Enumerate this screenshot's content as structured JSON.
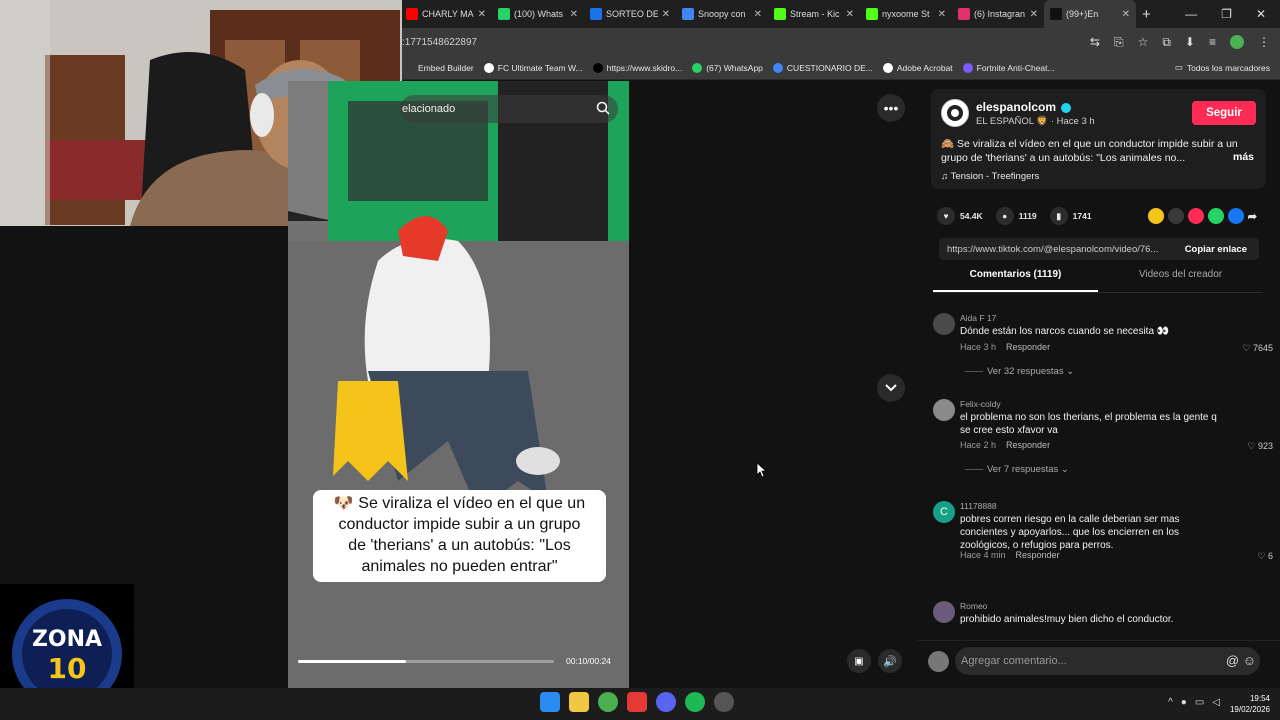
{
  "browser": {
    "tabs": [
      {
        "label": "CHARLY MA",
        "color": "#ff0000"
      },
      {
        "label": "(100) Whats",
        "color": "#25d366"
      },
      {
        "label": "SORTEO DE",
        "color": "#1a73e8"
      },
      {
        "label": "Snoopy con",
        "color": "#4285f4"
      },
      {
        "label": "Stream - Kic",
        "color": "#53fc18"
      },
      {
        "label": "nyxoome St",
        "color": "#53fc18"
      },
      {
        "label": "(6) Instagran",
        "color": "#e1306c"
      },
      {
        "label": "(99+)En",
        "color": "#111111"
      }
    ],
    "new_tab": "+",
    "url": ":1771548622897",
    "bookmarks": [
      {
        "label": "Embed Builder",
        "color": "#3a3a3a"
      },
      {
        "label": "FC Ultimate Team W...",
        "color": "#ffffff"
      },
      {
        "label": "https://www.skidro...",
        "color": "#000000"
      },
      {
        "label": "(67) WhatsApp",
        "color": "#25d366"
      },
      {
        "label": "CUESTIONARIO DE...",
        "color": "#4285f4"
      },
      {
        "label": "Adobe Acrobat",
        "color": "#ffffff"
      },
      {
        "label": "Fortnite Anti-Cheat...",
        "color": "#7b5cff"
      }
    ],
    "all_bookmarks": "Todos los marcadores"
  },
  "video": {
    "search_placeholder": "elacionado",
    "caption_line1": "🐶 Se viraliza el vídeo en el que un",
    "caption_line2": "conductor impide subir a un grupo",
    "caption_line3": "de 'therians' a un autobús: \"Los",
    "caption_line4": "animales no pueden entrar\"",
    "progress": 0.42,
    "time": "00:10/00:24"
  },
  "post": {
    "author": "elespanolcom",
    "author_sub": "EL ESPAÑOL 🦁 · Hace 3 h",
    "follow": "Seguir",
    "description": "🙈 Se viraliza el vídeo en el que un conductor impide subir a un grupo de 'therians' a un autobús: \"Los animales no...",
    "more": "más",
    "music": "♫  Tension - Treefingers",
    "likes": "54.4K",
    "comments_count": "1119",
    "saves": "1741",
    "share_colors": [
      "#f5c518",
      "#3a3a3a",
      "#fe2c55",
      "#25d366",
      "#1877f2"
    ],
    "link": "https://www.tiktok.com/@elespanolcom/video/76...",
    "copy_link": "Copiar enlace"
  },
  "panel_tabs": {
    "comments": "Comentarios (1119)",
    "creator_videos": "Videos del creador"
  },
  "comments": [
    {
      "user": "Aida F 17",
      "text": "Dónde están los narcos cuando se necesita 👀",
      "time": "Hace 3 h",
      "reply": "Responder",
      "likes": "7645",
      "replies": "Ver 32 respuestas ⌄",
      "avatar": "#4b4b4b"
    },
    {
      "user": "Felix-coldy",
      "text": "el problema no son los therians, el problema es la gente q se cree esto xfavor va",
      "time": "Hace 2 h",
      "reply": "Responder",
      "likes": "923",
      "replies": "Ver 7 respuestas ⌄",
      "avatar": "#8a8a8a"
    },
    {
      "user": "11178888",
      "text": "pobres corren riesgo en la calle deberian ser mas concientes y apoyarlos... que los encierren en los zoológicos, o refugios para perros.",
      "time": "Hace 4 min",
      "reply": "Responder",
      "likes": "6",
      "initial": "C",
      "avatar": "#16a085"
    },
    {
      "user": "Romeo",
      "text": "prohibido animales!muy bien dicho el conductor.",
      "avatar": "#6b5b7b"
    }
  ],
  "composer": {
    "placeholder": "Agregar comentario...",
    "icons": "@ ☺"
  },
  "taskbar": {
    "time": "19:54",
    "date": "19/02/2026"
  },
  "overlay": {
    "logo_text_line1": "ZONA",
    "logo_text_line2": "10"
  }
}
